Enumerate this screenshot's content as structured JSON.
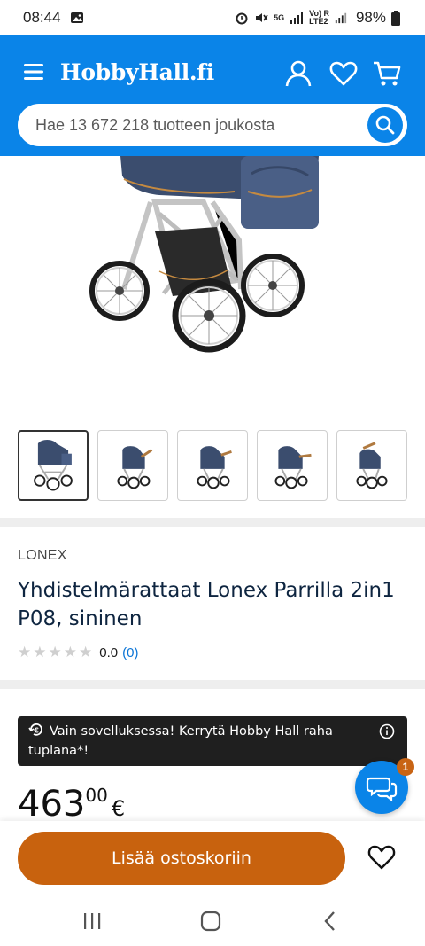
{
  "status_bar": {
    "time": "08:44",
    "network_5g": "5G",
    "volte": "Vo) R\nLTE2",
    "battery": "98%"
  },
  "header": {
    "logo": "HobbyHall.fi",
    "search_placeholder": "Hae 13 672 218 tuotteen joukosta"
  },
  "product": {
    "brand": "LONEX",
    "title": "Yhdistelmärattaat Lonex Parrilla 2in1 P08, sininen",
    "rating_value": "0.0",
    "rating_count": "(0)",
    "stars": 5
  },
  "promo": {
    "text": "Vain sovelluksessa! Kerrytä Hobby Hall raha tuplana*!"
  },
  "chat": {
    "badge": "1"
  },
  "price": {
    "integer": "463",
    "decimals": "00",
    "currency": "€"
  },
  "buy_bar": {
    "add_to_cart_label": "Lisää ostoskoriin"
  },
  "colors": {
    "brand_blue": "#0a84e8",
    "cta_orange": "#c8620e",
    "promo_bg": "#1f1f1f",
    "title_navy": "#0e2540"
  },
  "icons": [
    "menu-icon",
    "user-icon",
    "heart-icon",
    "cart-icon",
    "search-icon",
    "cashback-icon",
    "info-icon",
    "chat-icon",
    "recent-apps-icon",
    "home-icon",
    "back-icon"
  ]
}
